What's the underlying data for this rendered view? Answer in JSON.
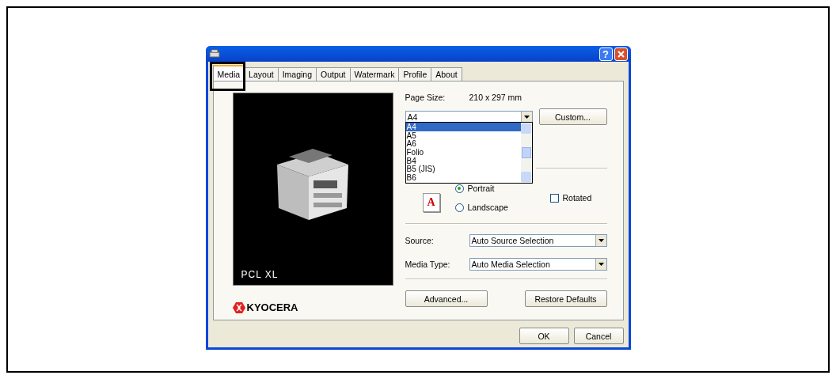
{
  "window": {
    "help_button": "?"
  },
  "tabs": [
    {
      "label": "Media",
      "selected": true
    },
    {
      "label": "Layout",
      "selected": false
    },
    {
      "label": "Imaging",
      "selected": false
    },
    {
      "label": "Output",
      "selected": false
    },
    {
      "label": "Watermark",
      "selected": false
    },
    {
      "label": "Profile",
      "selected": false
    },
    {
      "label": "About",
      "selected": false
    }
  ],
  "preview": {
    "caption": "PCL XL"
  },
  "logo": {
    "text": "KYOCERA"
  },
  "page_size": {
    "label": "Page Size:",
    "dimensions": "210 x 297 mm",
    "value": "A4",
    "custom_button": "Custom...",
    "options": [
      {
        "label": "A4",
        "selected": true
      },
      {
        "label": "A5",
        "selected": false
      },
      {
        "label": "A6",
        "selected": false
      },
      {
        "label": "Folio",
        "selected": false
      },
      {
        "label": "B4",
        "selected": false
      },
      {
        "label": "B5 (JIS)",
        "selected": false
      },
      {
        "label": "B6",
        "selected": false
      }
    ]
  },
  "orientation": {
    "icon_letter": "A",
    "options": [
      {
        "label": "Portrait",
        "selected": true
      },
      {
        "label": "Landscape",
        "selected": false
      }
    ],
    "rotated": {
      "label": "Rotated",
      "checked": false
    }
  },
  "source": {
    "label": "Source:",
    "value": "Auto Source Selection"
  },
  "media_type": {
    "label": "Media Type:",
    "value": "Auto Media Selection"
  },
  "buttons": {
    "advanced": "Advanced...",
    "restore": "Restore Defaults",
    "ok": "OK",
    "cancel": "Cancel"
  }
}
